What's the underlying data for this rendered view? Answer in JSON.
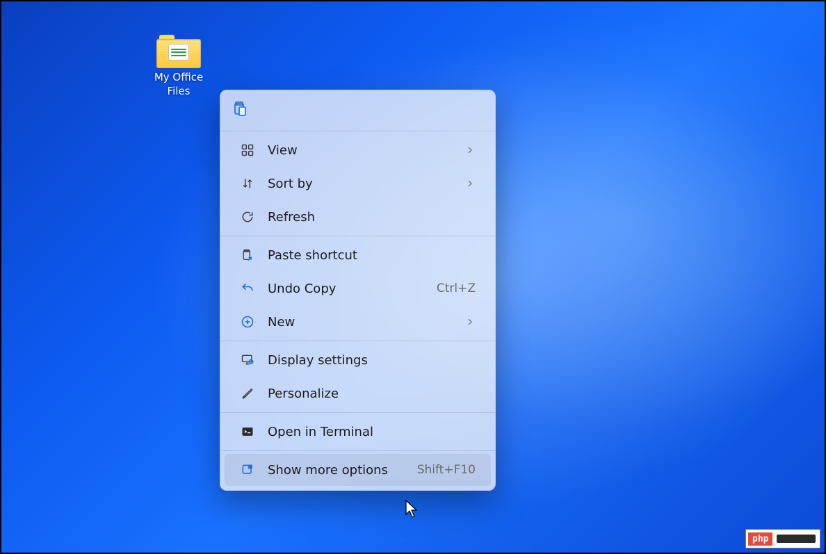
{
  "desktop": {
    "icons": [
      {
        "name": "my-office-files",
        "label": "My Office Files"
      }
    ]
  },
  "context_menu": {
    "top_actions": [
      {
        "name": "paste",
        "icon": "paste-icon"
      }
    ],
    "groups": [
      [
        {
          "name": "view",
          "icon": "view-icon",
          "label": "View",
          "submenu": true
        },
        {
          "name": "sort-by",
          "icon": "sort-icon",
          "label": "Sort by",
          "submenu": true
        },
        {
          "name": "refresh",
          "icon": "refresh-icon",
          "label": "Refresh"
        }
      ],
      [
        {
          "name": "paste-shortcut",
          "icon": "paste-shortcut-icon",
          "label": "Paste shortcut"
        },
        {
          "name": "undo-copy",
          "icon": "undo-icon",
          "label": "Undo Copy",
          "shortcut": "Ctrl+Z"
        },
        {
          "name": "new",
          "icon": "new-icon",
          "label": "New",
          "submenu": true
        }
      ],
      [
        {
          "name": "display-settings",
          "icon": "display-settings-icon",
          "label": "Display settings"
        },
        {
          "name": "personalize",
          "icon": "personalize-icon",
          "label": "Personalize"
        }
      ],
      [
        {
          "name": "open-in-terminal",
          "icon": "terminal-icon",
          "label": "Open in Terminal"
        }
      ],
      [
        {
          "name": "show-more-options",
          "icon": "show-more-icon",
          "label": "Show more options",
          "shortcut": "Shift+F10",
          "hovered": true
        }
      ]
    ]
  },
  "watermark": {
    "left": "php"
  }
}
